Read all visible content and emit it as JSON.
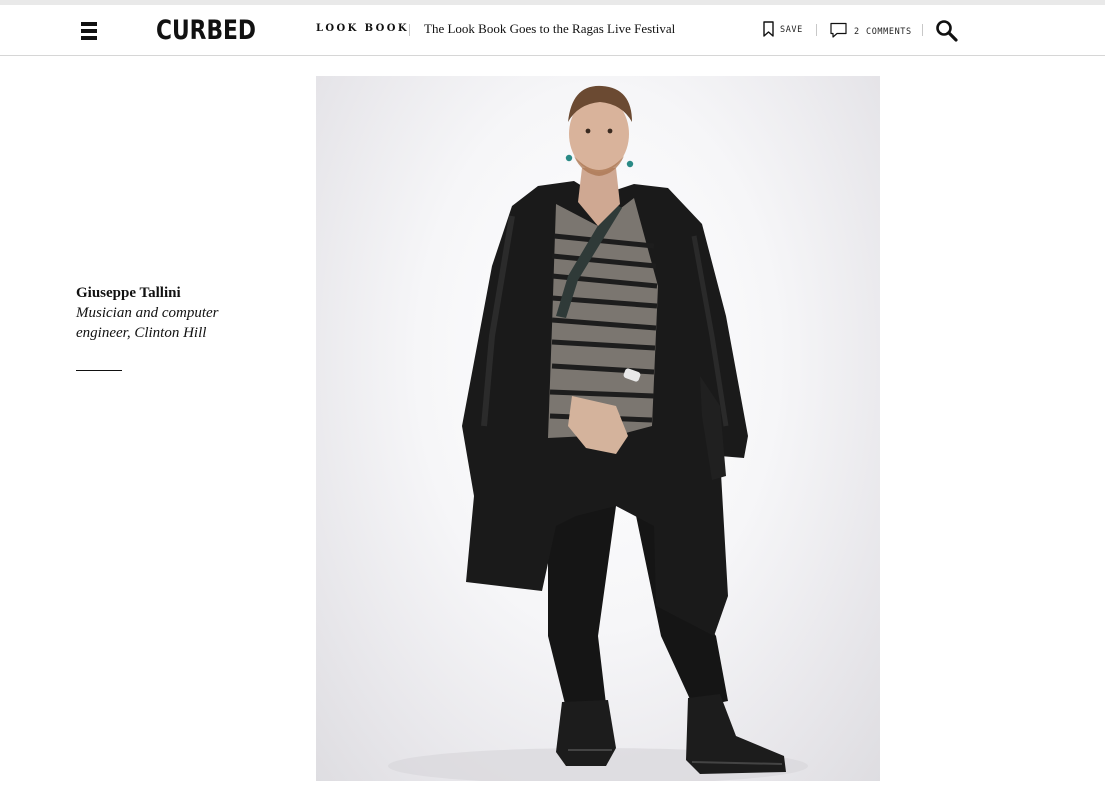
{
  "header": {
    "logo_text": "CURBED",
    "section": "LOOK BOOK",
    "headline": "The Look Book Goes to the Ragas Live Festival",
    "save_label": "SAVE",
    "comments_count": "2",
    "comments_label": "COMMENTS"
  },
  "icons": {
    "menu": "hamburger-icon",
    "save": "bookmark-icon",
    "comments": "comment-bubble-icon",
    "search": "magnifier-icon"
  },
  "caption": {
    "name": "Giuseppe Tallini",
    "role": "Musician and computer engineer, Clinton Hill"
  },
  "colors": {
    "text": "#111111",
    "header_border": "#d6d6d6",
    "photo_background": "#f2f2f4"
  }
}
